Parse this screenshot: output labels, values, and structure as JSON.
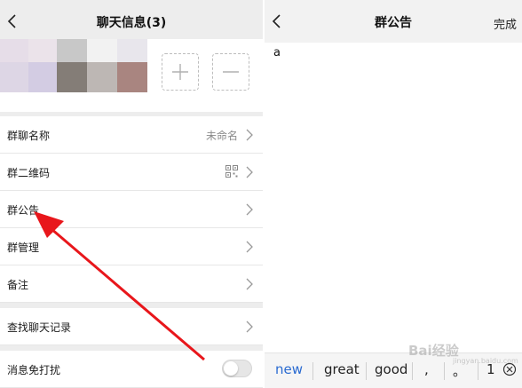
{
  "left": {
    "title": "聊天信息(3)",
    "members": {
      "avatars": [
        {
          "color": "#e6dde8"
        },
        {
          "color": "#ebe3ea"
        },
        {
          "color": "#c8c8c8"
        },
        {
          "color": "#f2f2f2"
        },
        {
          "color": "#e8e6ec"
        },
        {
          "color": "#ddd6e5"
        },
        {
          "color": "#d3cce3"
        },
        {
          "color": "#847d77"
        },
        {
          "color": "#bdb7b4"
        },
        {
          "color": "#a98580"
        }
      ]
    },
    "rows": {
      "group_name": {
        "label": "群聊名称",
        "value": "未命名"
      },
      "group_qr": {
        "label": "群二维码"
      },
      "group_notice": {
        "label": "群公告"
      },
      "group_manage": {
        "label": "群管理"
      },
      "remark": {
        "label": "备注"
      },
      "search_history": {
        "label": "查找聊天记录"
      },
      "mute": {
        "label": "消息免打扰",
        "enabled": false
      }
    }
  },
  "right": {
    "title": "群公告",
    "done_label": "完成",
    "notice_text": "a",
    "suggestions": [
      "new",
      "great",
      "good",
      ",",
      "。",
      "1"
    ]
  },
  "watermark": {
    "text": "Bai经验",
    "sub": "jingyan.baidu.com"
  },
  "colors": {
    "arrow": "#e8161b",
    "selected_suggestion": "#2a6bd1"
  }
}
